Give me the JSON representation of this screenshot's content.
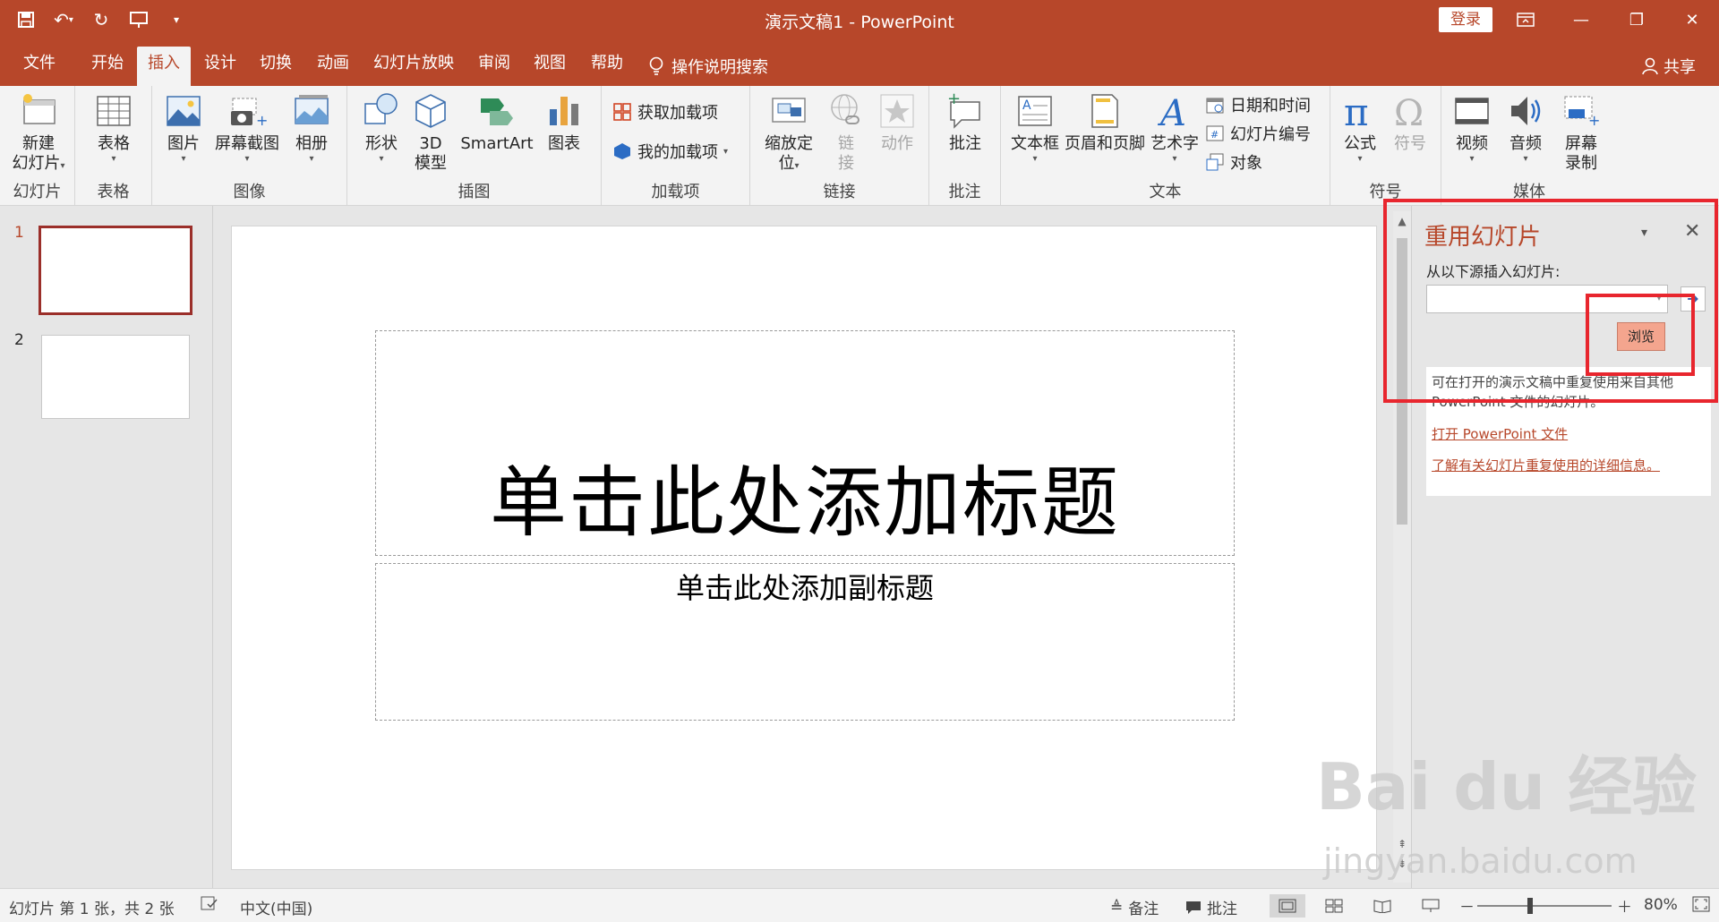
{
  "window": {
    "title": "演示文稿1  -  PowerPoint",
    "login_label": "登录"
  },
  "tabs": [
    {
      "label": "文件"
    },
    {
      "label": "开始"
    },
    {
      "label": "插入",
      "active": true
    },
    {
      "label": "设计"
    },
    {
      "label": "切换"
    },
    {
      "label": "动画"
    },
    {
      "label": "幻灯片放映"
    },
    {
      "label": "审阅"
    },
    {
      "label": "视图"
    },
    {
      "label": "帮助"
    }
  ],
  "tell_me": "操作说明搜索",
  "share_label": "共享",
  "ribbon": {
    "slides": {
      "group": "幻灯片",
      "new_slide_line1": "新建",
      "new_slide_line2": "幻灯片"
    },
    "tables": {
      "group": "表格",
      "table": "表格"
    },
    "images": {
      "group": "图像",
      "picture": "图片",
      "screenshot": "屏幕截图",
      "album": "相册"
    },
    "illustrations": {
      "group": "插图",
      "shapes": "形状",
      "model_line1": "3D",
      "model_line2": "模型",
      "smartart": "SmartArt",
      "chart": "图表"
    },
    "addins": {
      "group": "加载项",
      "get_addins": "获取加载项",
      "my_addins": "我的加载项"
    },
    "links": {
      "group": "链接",
      "zoom_line1": "缩放定",
      "zoom_line2": "位",
      "link_line1": "链",
      "link_line2": "接",
      "action": "动作"
    },
    "comments": {
      "group": "批注",
      "comment": "批注"
    },
    "text": {
      "group": "文本",
      "textbox": "文本框",
      "header_footer": "页眉和页脚",
      "wordart": "艺术字",
      "datetime": "日期和时间",
      "slide_number": "幻灯片编号",
      "object": "对象"
    },
    "symbols": {
      "group": "符号",
      "equation": "公式",
      "symbol": "符号"
    },
    "media": {
      "group": "媒体",
      "video": "视频",
      "audio": "音频",
      "screen_rec_line1": "屏幕",
      "screen_rec_line2": "录制"
    }
  },
  "thumbnails": [
    {
      "number": "1"
    },
    {
      "number": "2"
    }
  ],
  "slide": {
    "title_placeholder": "单击此处添加标题",
    "subtitle_placeholder": "单击此处添加副标题"
  },
  "reuse_pane": {
    "title": "重用幻灯片",
    "source_label": "从以下源插入幻灯片:",
    "source_value": "",
    "browse_label": "浏览",
    "info_text": "可在打开的演示文稿中重复使用来自其他 PowerPoint 文件的幻灯片。",
    "open_link": "打开 PowerPoint 文件",
    "learn_link": "了解有关幻灯片重复使用的详细信息。"
  },
  "watermark": {
    "logo": "Bai du 经验",
    "url": "jingyan.baidu.com"
  },
  "status": {
    "slide_info": "幻灯片 第 1 张，共 2 张",
    "language": "中文(中国)",
    "notes": "备注",
    "comments": "批注",
    "zoom": "80%"
  },
  "colors": {
    "accent": "#b7472a",
    "highlight_box": "#e8262e",
    "browse_button": "#f4a58e"
  }
}
